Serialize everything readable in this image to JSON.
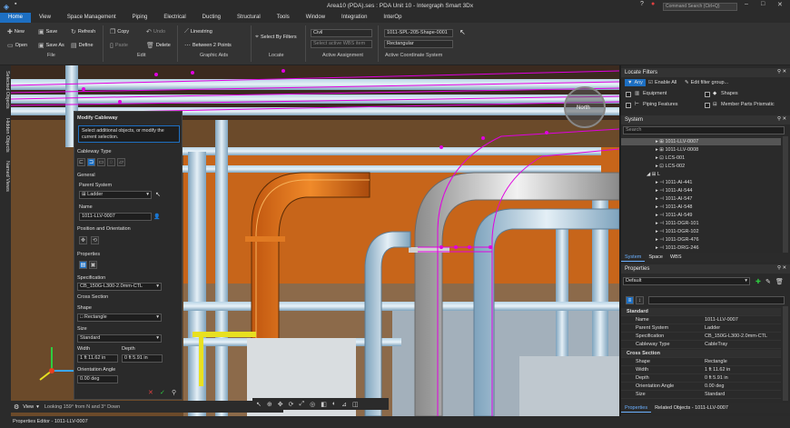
{
  "window": {
    "title": "Area10 (PDA).ses : PDA Unit 10 - Intergraph Smart 3Dx",
    "search_placeholder": "Command Search (Ctrl+Q)"
  },
  "menu": [
    "Home",
    "View",
    "Space Management",
    "Piping",
    "Electrical",
    "Ducting",
    "Structural",
    "Tools",
    "Window",
    "Integration",
    "InterOp"
  ],
  "ribbon": {
    "file": {
      "new": "New",
      "save": "Save",
      "refresh": "Refresh",
      "open": "Open",
      "save_as": "Save As",
      "define": "Define",
      "group": "File"
    },
    "edit": {
      "copy": "Copy",
      "undo": "Undo",
      "paste": "Paste",
      "delete": "Delete",
      "group": "Edit"
    },
    "graphic_aids": {
      "linestring": "Linestring",
      "between": "Between 2 Points",
      "group": "Graphic Aids"
    },
    "locate": {
      "select_by_filters": "Select By Filters",
      "group": "Locate"
    },
    "active_assignment": {
      "discipline": "Civil",
      "wbs_placeholder": "Select active WBS item",
      "group": "Active Assignment"
    },
    "active_coord": {
      "system": "1011-SPL-205-Shape-0001",
      "shape": "Rectangular",
      "group": "Active Coordinate System"
    }
  },
  "left_tabs": [
    "Selected Objects",
    "Hidden Objects",
    "Named Views"
  ],
  "modify": {
    "title": "Modify Cableway",
    "hint": "Select additional objects, or modify the current selection.",
    "cableway_type": "Cableway Type",
    "general": "General",
    "parent_system_label": "Parent System",
    "parent_system": "Ladder",
    "name_label": "Name",
    "name": "1011-LLV-0007",
    "position_label": "Position and Orientation",
    "properties_label": "Properties",
    "spec_label": "Specification",
    "spec": "CB_150G-L300-2.0mm-CTL",
    "cross_section": "Cross Section",
    "shape_label": "Shape",
    "shape": "Rectangle",
    "size_label": "Size",
    "size": "Standard",
    "width_label": "Width",
    "width": "1 ft 11.62 in",
    "depth_label": "Depth",
    "depth": "0 ft 5.91 in",
    "orient_label": "Orientation Angle",
    "orient": "0.00 deg"
  },
  "viewbar": {
    "view": "View",
    "look": "Looking 159° from N and 3° Down"
  },
  "compass": "North",
  "locate_filters": {
    "title": "Locate Filters",
    "any": "Any",
    "enable_all": "Enable All",
    "edit_group": "Edit filter group...",
    "items": [
      "Equipment",
      "Shapes",
      "Piping Features",
      "Member Parts Prismatic"
    ]
  },
  "system": {
    "title": "System",
    "search_placeholder": "Search",
    "tree": [
      "1011-LLV-0007",
      "1011-LLV-0008",
      "LCS-001",
      "LCS-002",
      "L",
      "1011-AI-441",
      "1011-AI-544",
      "1011-AI-547",
      "1011-AI-548",
      "1011-AI-549",
      "1011-DGR-101",
      "1011-DGR-102",
      "1011-DGR-476",
      "1011-DRG-246"
    ],
    "tabs": [
      "System",
      "Space",
      "WBS"
    ]
  },
  "properties": {
    "title": "Properties",
    "filter": "Default",
    "standard": "Standard",
    "rows": [
      {
        "k": "Name",
        "v": "1011-LLV-0007"
      },
      {
        "k": "Parent System",
        "v": "Ladder"
      },
      {
        "k": "Specification",
        "v": "CB_150G-L300-2.0mm-CTL"
      },
      {
        "k": "Cableway Type",
        "v": "CableTray"
      }
    ],
    "cross_section": "Cross Section",
    "rows2": [
      {
        "k": "Shape",
        "v": "Rectangle"
      },
      {
        "k": "Width",
        "v": "1 ft  11.62 in"
      },
      {
        "k": "Depth",
        "v": "0 ft  5.91 in"
      },
      {
        "k": "Orientation Angle",
        "v": "0.00 deg"
      },
      {
        "k": "Size",
        "v": "Standard"
      }
    ],
    "tabs": [
      "Properties",
      "Related Objects - 1011-LLV-0007"
    ]
  },
  "statusbar": "Properties Editor - 1011-LLV-0007"
}
